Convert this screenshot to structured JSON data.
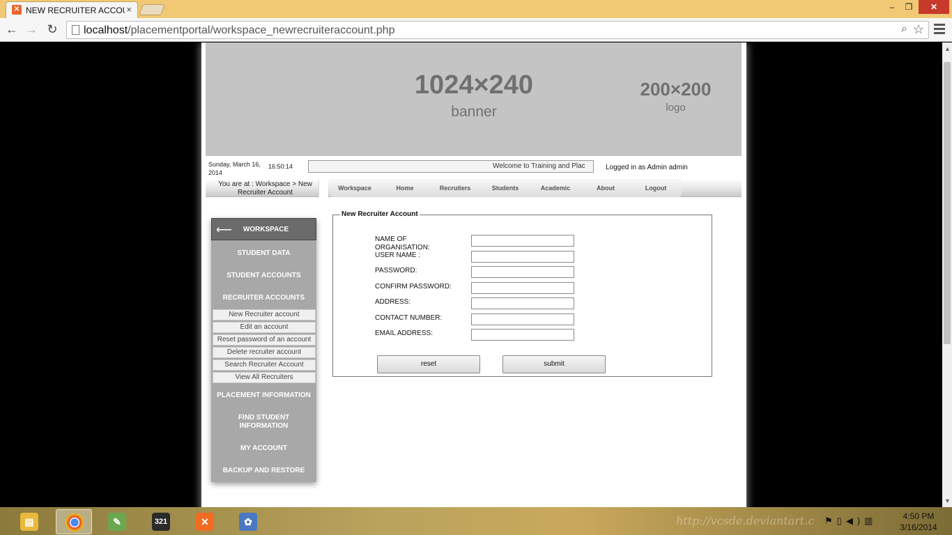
{
  "browser": {
    "tab_title": "NEW RECRUITER ACCOUNT",
    "tab_close": "×",
    "url_host": "localhost",
    "url_path": "/placementportal/workspace_newrecruiteraccount.php",
    "window_controls": {
      "minimize": "‒",
      "maximize": "❐",
      "close": "✕"
    }
  },
  "banner": {
    "size_text": "1024×240",
    "caption": "banner",
    "logo_size": "200×200",
    "logo_caption": "logo"
  },
  "header": {
    "date": "Sunday, March 16, 2014",
    "time": "16:50:14",
    "marquee": "Welcome to Training and Plac",
    "logged_in": "Logged in as Admin admin"
  },
  "navbar": {
    "breadcrumb": "You are at : Workspace > New Recruiter Account",
    "items": [
      {
        "label": "Workspace"
      },
      {
        "label": "Home"
      },
      {
        "label": "Recruiters"
      },
      {
        "label": "Students"
      },
      {
        "label": "Academic"
      },
      {
        "label": "About"
      },
      {
        "label": "Logout"
      }
    ]
  },
  "sidebar": {
    "back_arrow": "⟵",
    "head": "WORKSPACE",
    "sections": [
      {
        "label": "STUDENT DATA"
      },
      {
        "label": "STUDENT ACCOUNTS"
      },
      {
        "label": "RECRUITER ACCOUNTS"
      },
      {
        "label": "PLACEMENT INFORMATION"
      },
      {
        "label": "FIND STUDENT INFORMATION"
      },
      {
        "label": "MY ACCOUNT"
      },
      {
        "label": "BACKUP AND RESTORE"
      }
    ],
    "sub_items": [
      {
        "label": "New Recruiter account"
      },
      {
        "label": "Edit an account"
      },
      {
        "label": "Reset password of an account"
      },
      {
        "label": "Delete recruiter account"
      },
      {
        "label": "Search Recruiter Account"
      },
      {
        "label": "View All Recruiters"
      }
    ]
  },
  "form": {
    "legend": "New Recruiter Account",
    "fields": [
      {
        "label": "NAME OF ORGANISATION:",
        "value": ""
      },
      {
        "label": "USER NAME :",
        "value": ""
      },
      {
        "label": "PASSWORD:",
        "value": ""
      },
      {
        "label": "CONFIRM PASSWORD:",
        "value": ""
      },
      {
        "label": "ADDRESS:",
        "value": ""
      },
      {
        "label": "CONTACT NUMBER:",
        "value": ""
      },
      {
        "label": "EMAIL ADDRESS:",
        "value": ""
      }
    ],
    "reset_label": "reset",
    "submit_label": "submit"
  },
  "taskbar": {
    "apps": [
      {
        "icon": "file-explorer-icon",
        "color": "#e8b93a"
      },
      {
        "icon": "chrome-icon",
        "color": "#3b8c3f"
      },
      {
        "icon": "notepad-plus-icon",
        "color": "#6aa84f"
      },
      {
        "icon": "media-player-classic-icon",
        "color": "#2b2b2b",
        "text": "321"
      },
      {
        "icon": "xampp-icon",
        "color": "#f26b22"
      },
      {
        "icon": "paint-icon",
        "color": "#4a78c2"
      }
    ],
    "watermark": "http://vcsde.deviantart.c",
    "clock_time": "4:50 PM",
    "clock_date": "3/16/2014"
  }
}
